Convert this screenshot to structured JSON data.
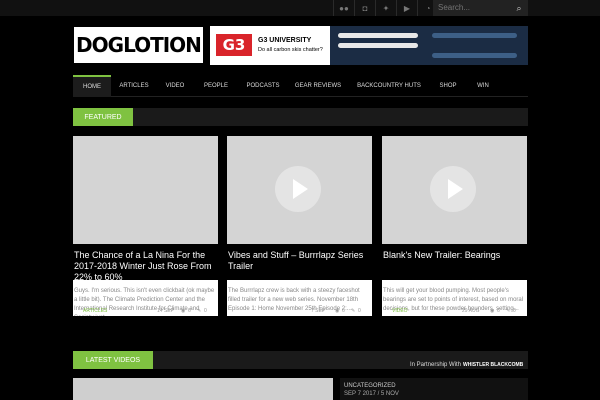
{
  "topbar": {
    "social_icons": [
      "flickr-icon",
      "instagram-icon",
      "twitter-icon",
      "youtube-icon",
      "rss-icon"
    ],
    "search_placeholder": "Search...",
    "search_icon": "search-icon"
  },
  "logo": {
    "text": "DOGLOTION"
  },
  "ad": {
    "brand": "G3",
    "headline": "G3 UNIVERSITY",
    "subhead": "Do all carbon skis chatter?"
  },
  "nav": {
    "items": [
      "HOME",
      "ARTICLES",
      "VIDEO",
      "PEOPLE",
      "PODCASTS",
      "GEAR REVIEWS",
      "BACKCOUNTRY HUTS",
      "SHOP",
      "WIN"
    ],
    "active": "HOME"
  },
  "featured": {
    "label": "FEATURED",
    "cards": [
      {
        "title": "The Chance of a La Nina For the 2017-2018 Winter Just Rose From 22% to 60%",
        "excerpt": "Guys. I'm serious. This isn't even clickbait (ok maybe a little bit). The Climate Prediction Center and the International Research Institute for Climate and Society just...",
        "category": "ARTICLES",
        "date": "14 SEP",
        "views": "6",
        "comments": "0",
        "video": false
      },
      {
        "title": "Vibes and Stuff – Burrrlapz Series Trailer",
        "excerpt": "The Burrrlapz crew is back with a steezy faceshot filled trailer for a new web series. November 18th Episode 1: Home November 25th Episode 2:...",
        "category": "",
        "date": "7 SEP",
        "views": "6",
        "comments": "0",
        "video": true
      },
      {
        "title": "Blank's New Trailer: Bearings",
        "excerpt": "This will get your blood pumping. Most people's bearings are set to points of interest, based on moral decisions, but for these powder hounders, setting...",
        "category": "VIDEO",
        "date": "29 AUG",
        "views": "6",
        "comments": "0",
        "video": true
      }
    ]
  },
  "latest": {
    "label": "LATEST VIDEOS",
    "partner_text": "In Partnership With",
    "partner_logo": "WHISTLER BLACKCOMB",
    "right_title": "UNCATEGORIZED",
    "right_date": "SEP 7 2017 / 5 NOV"
  },
  "colors": {
    "accent": "#7fc241",
    "background": "#000000"
  }
}
